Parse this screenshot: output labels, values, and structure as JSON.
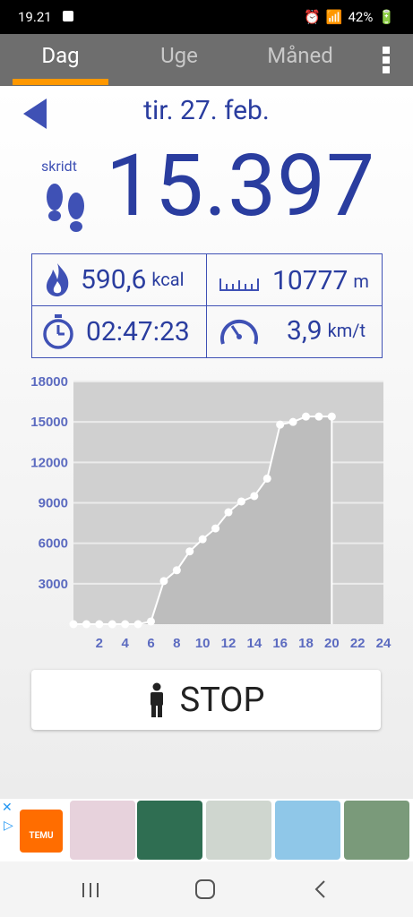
{
  "status": {
    "time": "19.21",
    "battery": "42%"
  },
  "tabs": [
    {
      "label": "Dag"
    },
    {
      "label": "Uge"
    },
    {
      "label": "Måned"
    }
  ],
  "date": "tir. 27. feb.",
  "steps": {
    "label": "skridt",
    "value": "15.397"
  },
  "stats": {
    "calories": {
      "value": "590,6",
      "unit": "kcal"
    },
    "distance": {
      "value": "10777",
      "unit": "m"
    },
    "duration": {
      "value": "02:47:23"
    },
    "speed": {
      "value": "3,9",
      "unit": "km/t"
    }
  },
  "chart_data": {
    "type": "area",
    "ylabel_ticks": [
      "3000",
      "6000",
      "9000",
      "12000",
      "15000",
      "18000"
    ],
    "xlabel_ticks": [
      "2",
      "4",
      "6",
      "8",
      "10",
      "12",
      "14",
      "16",
      "18",
      "20",
      "22",
      "24"
    ],
    "ylim": [
      0,
      18000
    ],
    "xlim": [
      0,
      24
    ],
    "grid": true,
    "x": [
      0,
      1,
      2,
      3,
      4,
      5,
      6,
      7,
      8,
      9,
      10,
      11,
      12,
      13,
      14,
      15,
      16,
      17,
      18,
      19,
      20
    ],
    "values": [
      0,
      0,
      0,
      0,
      0,
      0,
      200,
      3200,
      4000,
      5400,
      6300,
      7100,
      8300,
      9100,
      9500,
      10800,
      14800,
      15000,
      15400,
      15400,
      15400
    ],
    "colors": {
      "area": "#bdbdbd",
      "bg": "#d0d0d0",
      "line": "#ffffff",
      "axis_text": "#5c6bc0"
    }
  },
  "stop_button": {
    "label": "STOP"
  },
  "ad": {
    "brand": "TEMU"
  }
}
